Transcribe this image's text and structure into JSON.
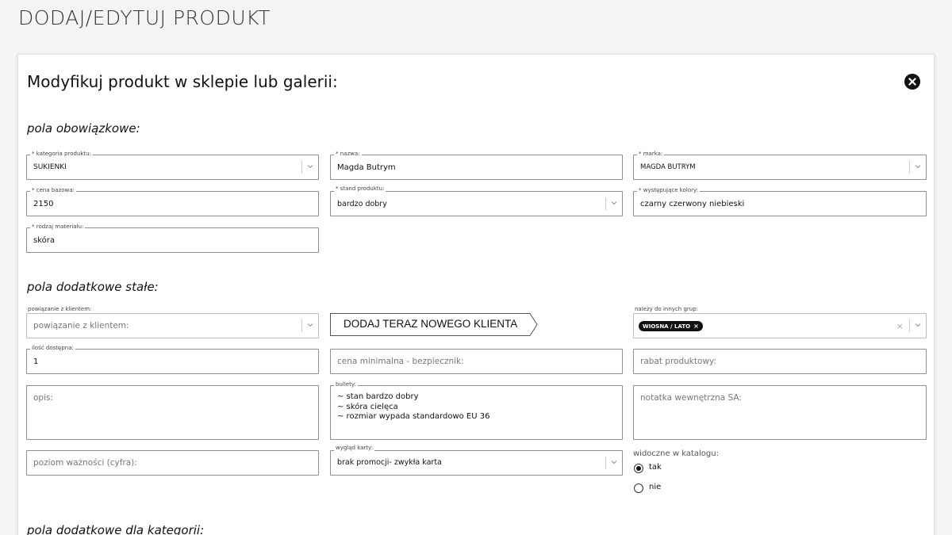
{
  "page": {
    "title": "DODAJ/EDYTUJ PRODUKT"
  },
  "modal": {
    "title": "Modyfikuj produkt w sklepie lub galerii:"
  },
  "sections": {
    "required": "pola obowiązkowe:",
    "extra": "pola dodatkowe stałe:",
    "category": "pola dodatkowe dla kategorii:"
  },
  "required_fields": {
    "category": {
      "label": "* kategoria produktu:",
      "value": "SUKIENKI"
    },
    "name": {
      "label": "* nazwa:",
      "value": "Magda Butrym"
    },
    "brand": {
      "label": "* marka:",
      "value": "MAGDA BUTRYM"
    },
    "base_price": {
      "label": "* cena bazowa:",
      "value": "2150"
    },
    "condition": {
      "label": "* stand produktu:",
      "value": "bardzo dobry"
    },
    "colors": {
      "label": "* występujące kolory:",
      "value": "czarny czerwony niebieski"
    },
    "material": {
      "label": "* rodzaj materiału:",
      "value": "skóra"
    }
  },
  "extra_fields": {
    "client": {
      "label": "powiązanie z klientem:",
      "placeholder": "powiązanie z klientem:"
    },
    "add_client_button": "DODAJ TERAZ NOWEGO KLIENTA",
    "groups": {
      "label": "należy do innych grup:",
      "tag": "WIOSNA / LATO",
      "tag_remove": "×",
      "clear": "×"
    },
    "quantity": {
      "label": "ilość dostępna:",
      "value": "1"
    },
    "min_price": {
      "placeholder": "cena minimalna - bezpiecznik:"
    },
    "discount": {
      "placeholder": "rabat produktowy:"
    },
    "description": {
      "placeholder": "opis:"
    },
    "bullets": {
      "label": "bullety:",
      "lines": [
        "~ stan bardzo dobry",
        "~ skóra cielęca",
        "~ rozmiar wypada standardowo EU 36"
      ]
    },
    "internal_note": {
      "placeholder": "notatka wewnętrzna SA:"
    },
    "priority": {
      "placeholder": "poziom ważności (cyfra):"
    },
    "card_look": {
      "label": "wygląd karty:",
      "value": "brak promocji- zwykła karta"
    },
    "catalog_visibility": {
      "label": "widoczne w katalogu:",
      "options": [
        {
          "label": "tak",
          "checked": true
        },
        {
          "label": "nie",
          "checked": false
        }
      ]
    }
  }
}
